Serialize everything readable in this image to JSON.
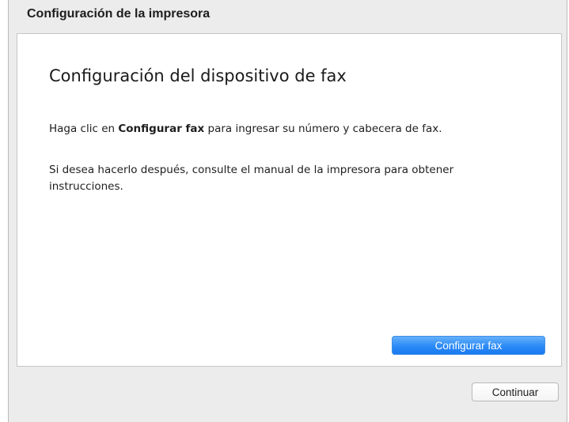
{
  "window": {
    "title": "Configuración de la impresora"
  },
  "content": {
    "heading": "Configuración del dispositivo de fax",
    "paragraph1": {
      "prefix": "Haga clic en ",
      "emphasis": "Configurar fax",
      "suffix": " para ingresar su número y cabecera de fax."
    },
    "paragraph2": "Si desea hacerlo después, consulte el manual de la impresora para obtener instrucciones."
  },
  "buttons": {
    "primary_label": "Configurar fax",
    "secondary_label": "Continuar"
  },
  "colors": {
    "primary_button": "#2a8af6",
    "window_background": "#ececec",
    "panel_background": "#ffffff"
  }
}
